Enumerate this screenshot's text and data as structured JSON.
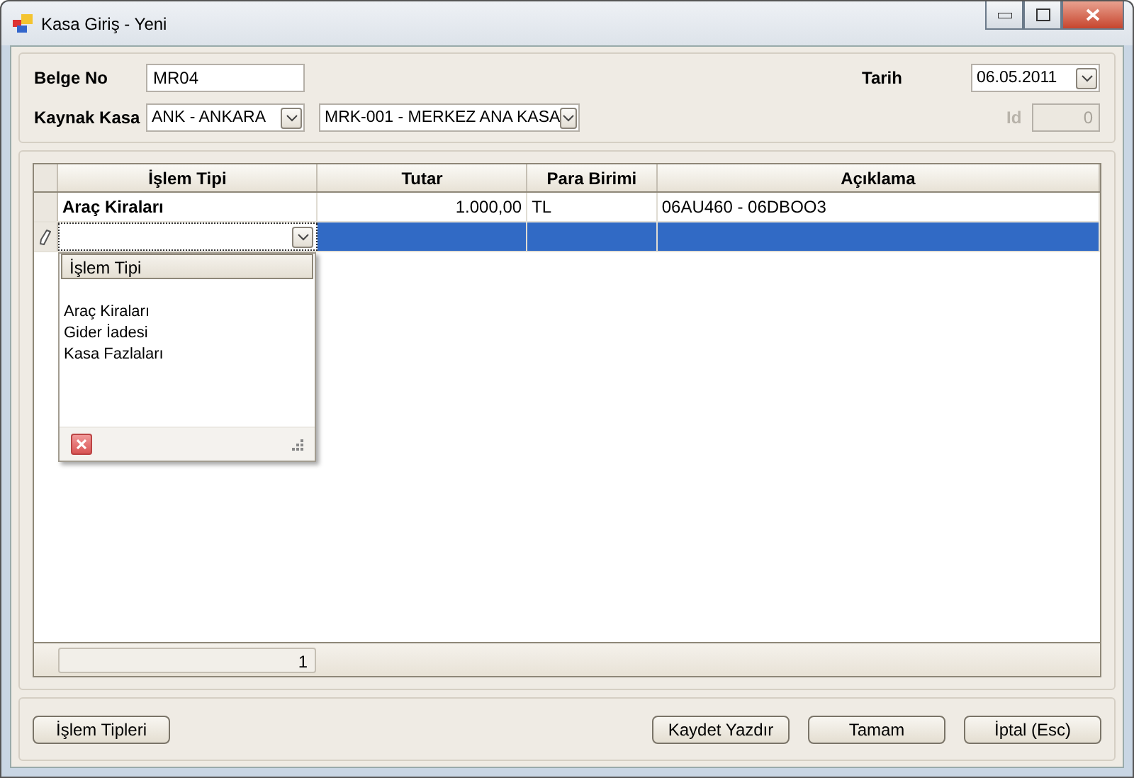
{
  "window": {
    "title": "Kasa Giriş - Yeni"
  },
  "form": {
    "belge_no": {
      "label": "Belge No",
      "value": "MR04"
    },
    "tarih": {
      "label": "Tarih",
      "value": "06.05.2011"
    },
    "kaynak_kasa": {
      "label": "Kaynak Kasa",
      "value": "ANK - ANKARA"
    },
    "kasa": {
      "value": "MRK-001 - MERKEZ ANA KASA"
    },
    "id": {
      "label": "Id",
      "value": "0",
      "disabled": true
    }
  },
  "grid": {
    "columns": [
      {
        "label": "İşlem Tipi",
        "kind": "text"
      },
      {
        "label": "Tutar",
        "kind": "amount"
      },
      {
        "label": "Para Birimi",
        "kind": "text"
      },
      {
        "label": "Açıklama",
        "kind": "text"
      }
    ],
    "rows": [
      {
        "cells": [
          "Araç Kiraları",
          "1.000,00",
          "TL",
          "06AU460 - 06DBOO3"
        ],
        "selected": false,
        "editing": false
      },
      {
        "selected": true,
        "editing": true
      }
    ],
    "footer": {
      "count": "1"
    },
    "dropdown": {
      "header": "İşlem Tipi",
      "items": [
        "Araç Kiraları",
        "Gider İadesi",
        "Kasa Fazlaları"
      ]
    }
  },
  "buttons_left": [
    "İşlem Tipleri"
  ],
  "buttons_right": [
    "Kaydet Yazdır",
    "Tamam",
    "İptal (Esc)"
  ]
}
